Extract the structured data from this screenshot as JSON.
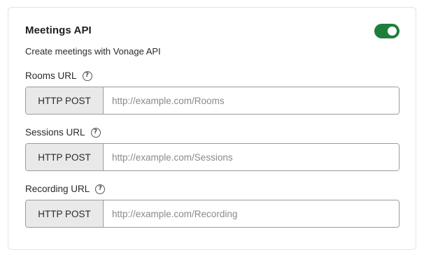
{
  "section": {
    "title": "Meetings API",
    "subtitle": "Create meetings with Vonage API",
    "toggle_on": true,
    "accent_color": "#1e7f3c"
  },
  "fields": [
    {
      "label": "Rooms URL",
      "method": "HTTP POST",
      "value": "",
      "placeholder": "http://example.com/Rooms"
    },
    {
      "label": "Sessions URL",
      "method": "HTTP POST",
      "value": "",
      "placeholder": "http://example.com/Sessions"
    },
    {
      "label": "Recording URL",
      "method": "HTTP POST",
      "value": "",
      "placeholder": "http://example.com/Recording"
    }
  ],
  "icons": {
    "help": "help-circle-icon",
    "help_glyph": "?"
  }
}
